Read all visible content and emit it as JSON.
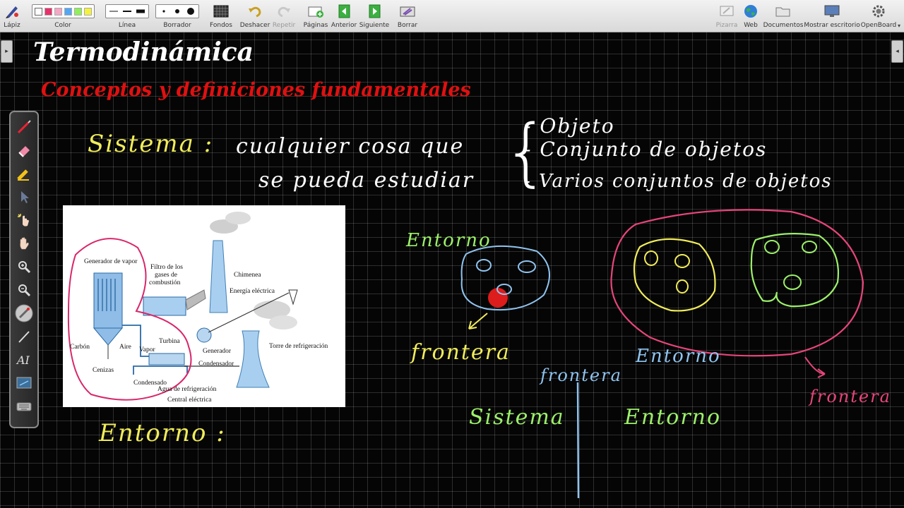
{
  "toolbar": {
    "pen": "Lápiz",
    "color": "Color",
    "line": "Línea",
    "eraser": "Borrador",
    "backgrounds": "Fondos",
    "undo": "Deshacer",
    "redo": "Repetir",
    "pages": "Páginas",
    "previous": "Anterior",
    "next": "Siguiente",
    "erase": "Borrar",
    "board": "Pizarra",
    "web": "Web",
    "documents": "Documentos",
    "show_desktop": "Mostrar escritorio",
    "openboard": "OpenBoard",
    "swatch_colors": [
      "#e8316b",
      "#f5a7c6",
      "#52a7f5",
      "#8ef05a",
      "#f4f23d"
    ]
  },
  "board": {
    "title": "Termodinámica",
    "subtitle": "Conceptos y definiciones fundamentales",
    "ink": {
      "sistema_label": "Sistema :",
      "sistema_def_1": "cualquier cosa que",
      "sistema_def_2": "se pueda estudiar",
      "list_1": "- Objeto",
      "list_2": "- Conjunto de objetos",
      "list_3": "- Varios conjuntos de objetos",
      "entorno_label": "Entorno :",
      "entorno_1": "Entorno",
      "frontera_1": "frontera",
      "entorno_2": "Entorno",
      "frontera_2": "frontera",
      "frontera_3": "frontera",
      "sistema_2": "Sistema",
      "entorno_3": "Entorno"
    },
    "colors": {
      "title": "#ffffff",
      "subtitle": "#e01010",
      "yellow": "#f0ec5a",
      "green": "#9cf06a",
      "blue": "#8fc4f0",
      "pink": "#e8457a",
      "red_dot": "#dd1c1c"
    }
  },
  "figure": {
    "labels": {
      "generator": "Generador de vapor",
      "filter_1": "Filtro de los",
      "filter_2": "gases de",
      "filter_3": "combustión",
      "chimney": "Chimenea",
      "energy": "Energía eléctrica",
      "coal": "Carbón",
      "air": "Aire",
      "steam": "Vapor",
      "turbine": "Turbina",
      "gen": "Generador",
      "condenser": "Condensador",
      "tower": "Torre de refrigeración",
      "ash": "Cenizas",
      "condensate": "Condensado",
      "water": "Agua de refrigeración",
      "plant": "Central eléctrica"
    }
  },
  "palette": {
    "icons": [
      "pen-icon",
      "eraser-icon",
      "marker-icon",
      "selector-icon",
      "interact-icon",
      "hand-icon",
      "zoom-in-icon",
      "zoom-out-icon",
      "laser-pointer-icon",
      "line-icon",
      "text-icon",
      "capture-icon",
      "keyboard-icon"
    ]
  }
}
